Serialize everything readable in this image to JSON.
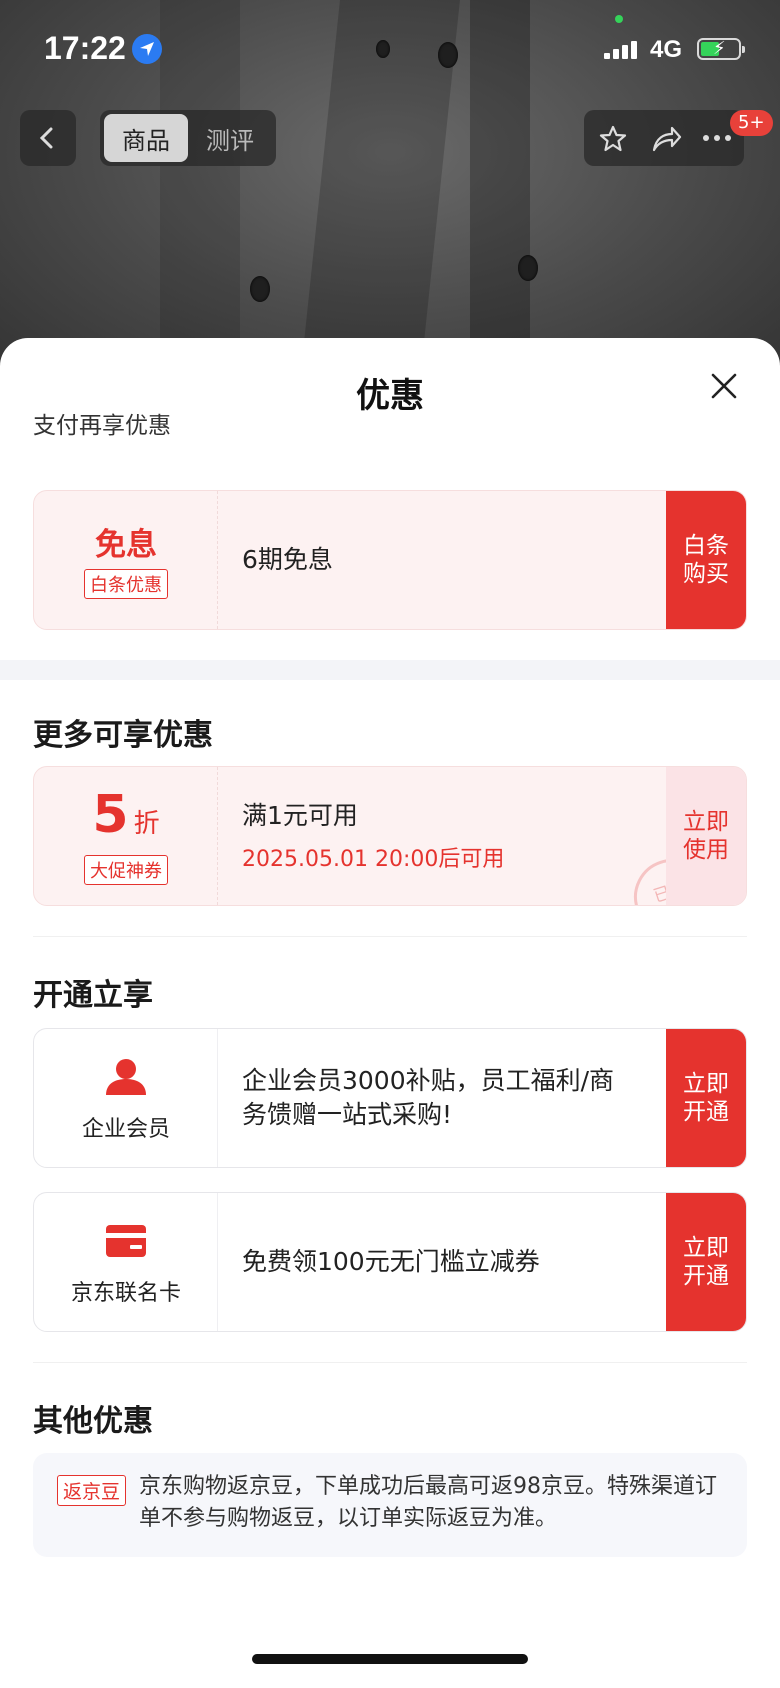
{
  "status_bar": {
    "time": "17:22",
    "network": "4G"
  },
  "nav": {
    "tabs": [
      "商品",
      "测评"
    ],
    "badge": "5+"
  },
  "sheet": {
    "title": "优惠",
    "pay_section_label": "支付再享优惠",
    "baitiao_card": {
      "left_title": "免息",
      "left_tag": "白条优惠",
      "text": "6期免息",
      "action": "白条购买"
    },
    "more_section_title": "更多可享优惠",
    "coupon_card": {
      "value": "5",
      "unit": "折",
      "left_tag": "大促神券",
      "text": "满1元可用",
      "sub": "2025.05.01 20:00后可用",
      "stamp": "已领",
      "action": "立即使用"
    },
    "open_section_title": "开通立享",
    "enterprise_card": {
      "left_label": "企业会员",
      "text": "企业会员3000补贴，员工福利/商务馈赠一站式采购!",
      "action": "立即开通"
    },
    "jd_card": {
      "left_label": "京东联名卡",
      "text": "免费领100元无门槛立减券",
      "action": "立即开通"
    },
    "other_section_title": "其他优惠",
    "other": {
      "tag": "返京豆",
      "text": "京东购物返京豆，下单成功后最高可返98京豆。特殊渠道订单不参与购物返豆，以订单实际返豆为准。"
    }
  },
  "colors": {
    "accent": "#e5332e",
    "pink_bg": "#fdf2f2"
  }
}
